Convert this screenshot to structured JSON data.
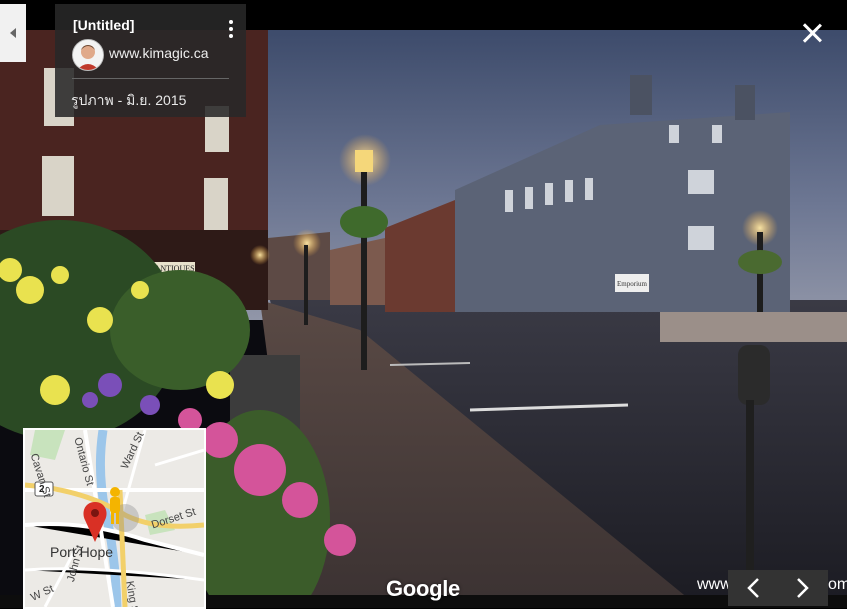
{
  "info": {
    "title": "[Untitled]",
    "author": "www.kimagic.ca",
    "date": "รูปภาพ - มิ.ย. 2015"
  },
  "map": {
    "streets": [
      "Cavan St",
      "Ontario St",
      "Ward St",
      "Dorset St",
      "John St",
      "King St",
      "W St"
    ],
    "town": "Port Hope",
    "route_number": "2"
  },
  "logo": "Google",
  "credit_partial": "www",
  "credit_tail": "om",
  "shop_sign": "SMITHS CREEK ANTIQUES",
  "store_sign": "Emporium",
  "icons": {
    "back": "chevron-left-icon",
    "menu": "more-vert-icon",
    "close": "close-icon",
    "prev": "chevron-left-icon",
    "next": "chevron-right-icon",
    "pegman": "pegman-icon",
    "marker": "map-pin-icon"
  }
}
